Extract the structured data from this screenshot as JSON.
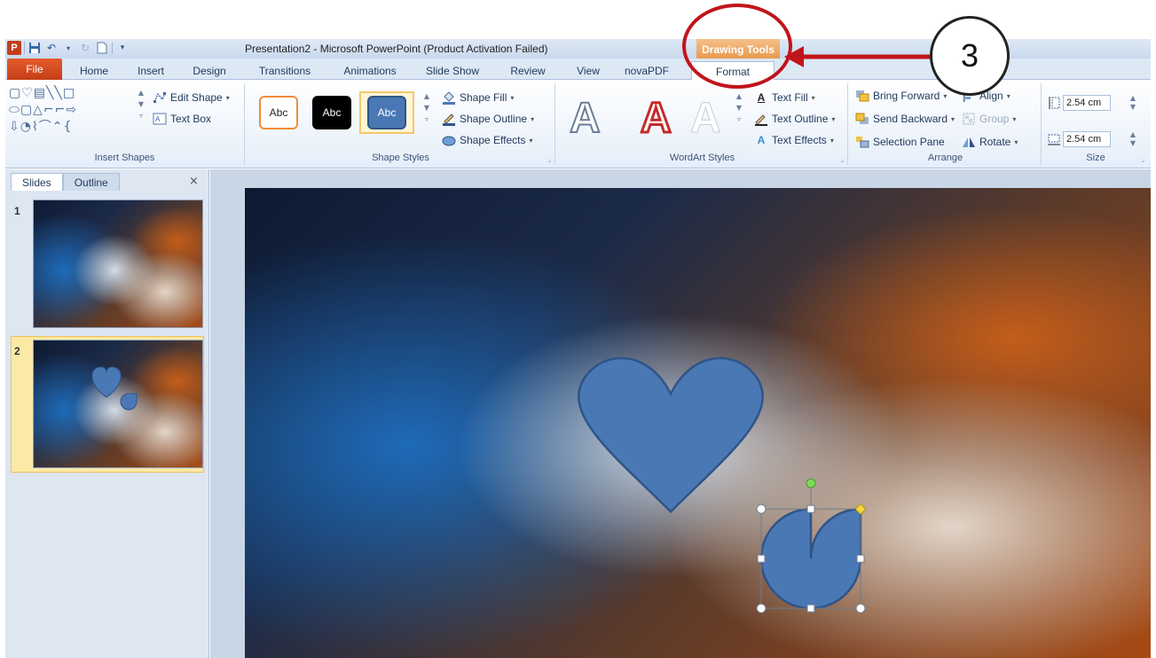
{
  "window": {
    "title": "Presentation2 - Microsoft PowerPoint (Product Activation Failed)",
    "context_tab_header": "Drawing Tools"
  },
  "quick_access": {
    "app_icon": "P"
  },
  "tabs": [
    "File",
    "Home",
    "Insert",
    "Design",
    "Transitions",
    "Animations",
    "Slide Show",
    "Review",
    "View",
    "novaPDF",
    "Format"
  ],
  "ribbon": {
    "insert_shapes": {
      "label": "Insert Shapes",
      "edit_shape": "Edit Shape",
      "text_box": "Text Box"
    },
    "shape_styles": {
      "label": "Shape Styles",
      "swatches": [
        "Abc",
        "Abc",
        "Abc"
      ],
      "shape_fill": "Shape Fill",
      "shape_outline": "Shape Outline",
      "shape_effects": "Shape Effects"
    },
    "wordart_styles": {
      "label": "WordArt Styles",
      "letter": "A",
      "text_fill": "Text Fill",
      "text_outline": "Text Outline",
      "text_effects": "Text Effects"
    },
    "arrange": {
      "label": "Arrange",
      "bring_forward": "Bring Forward",
      "send_backward": "Send Backward",
      "selection_pane": "Selection Pane",
      "align": "Align",
      "group": "Group",
      "rotate": "Rotate"
    },
    "size": {
      "label": "Size",
      "height": "2.54 cm",
      "width": "2.54 cm"
    }
  },
  "slides_pane": {
    "tabs": [
      "Slides",
      "Outline"
    ],
    "close": "×",
    "thumbnails": [
      {
        "number": "1"
      },
      {
        "number": "2"
      }
    ]
  },
  "annotation": {
    "number": "3"
  },
  "colors": {
    "shape_fill": "#4a78b5",
    "shape_outline": "#2f5487",
    "annotation_red": "#c0151a",
    "file_tab": "#d04a1f",
    "context_tab": "#e89a4e"
  }
}
